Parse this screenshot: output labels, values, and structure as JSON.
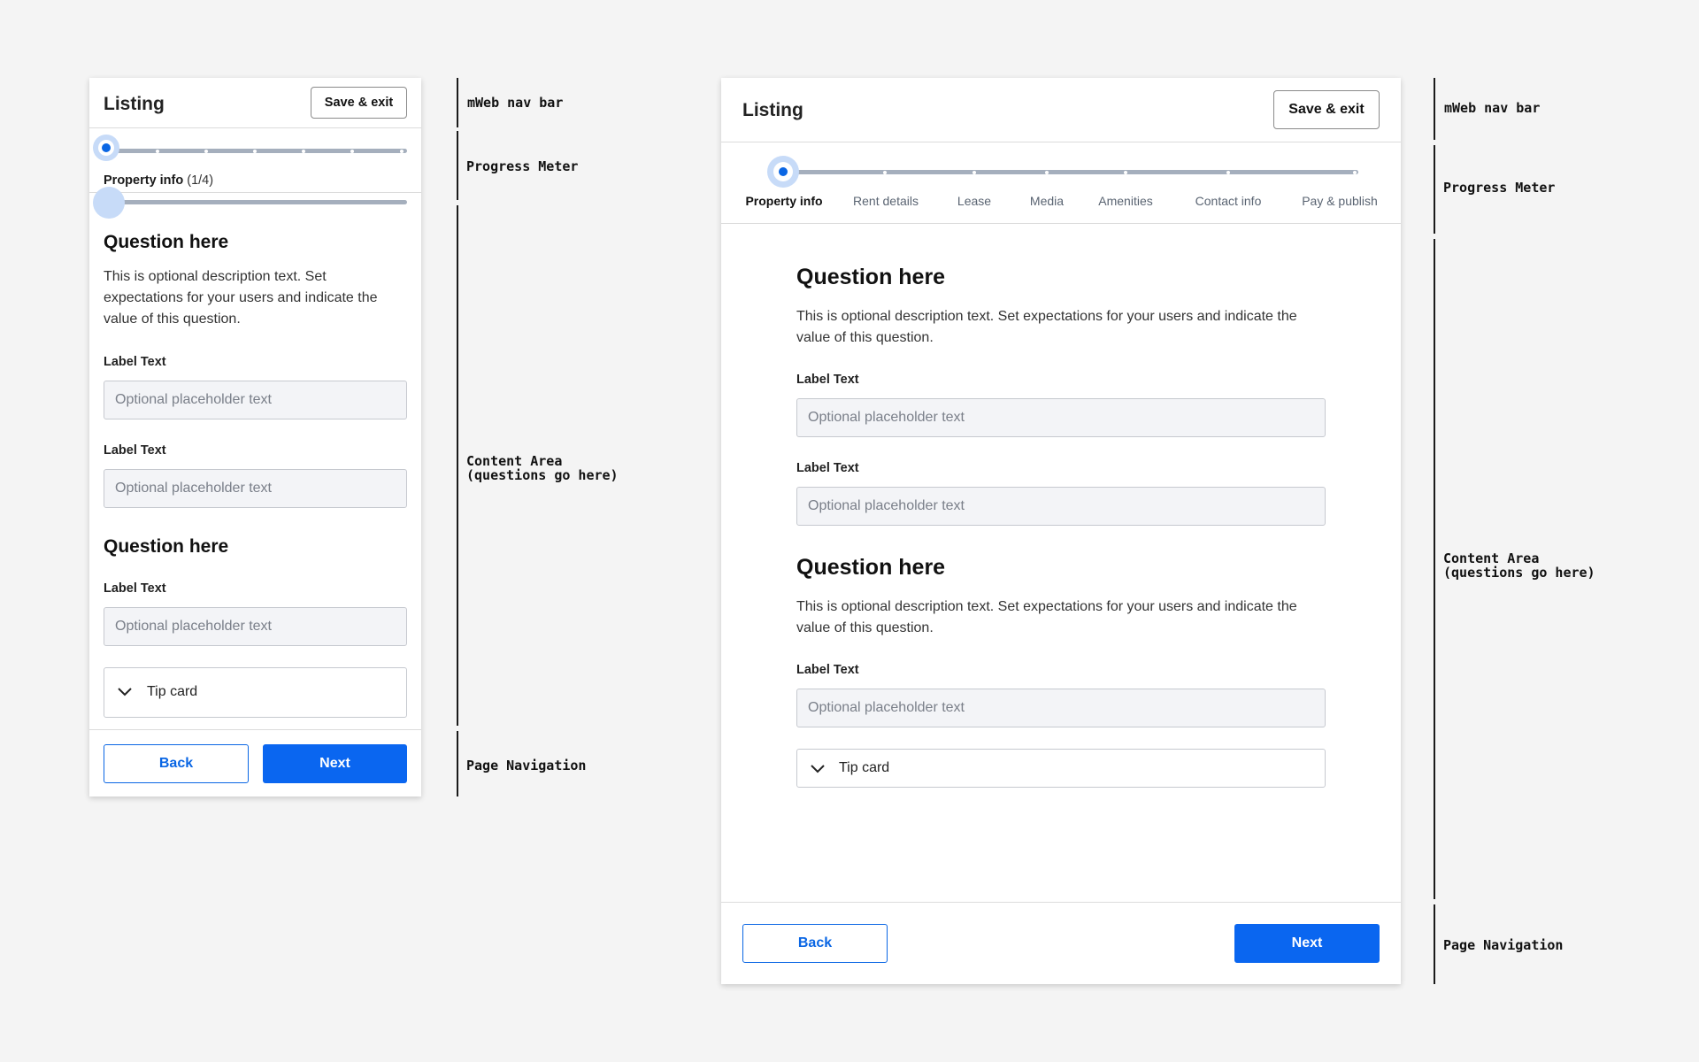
{
  "mobile": {
    "nav": {
      "title": "Listing",
      "save_label": "Save & exit"
    },
    "progress": {
      "current_step": 1,
      "total_steps": 4,
      "step_name": "Property info",
      "step_count": "(1/4)"
    },
    "section1": {
      "title": "Question here",
      "description": "This is optional description text. Set expectations for your users and indicate the value of this question.",
      "fields": [
        {
          "label": "Label Text",
          "placeholder": "Optional placeholder text"
        },
        {
          "label": "Label Text",
          "placeholder": "Optional placeholder text"
        }
      ]
    },
    "section2": {
      "title": "Question here",
      "fields": [
        {
          "label": "Label Text",
          "placeholder": "Optional placeholder text"
        }
      ],
      "tip_label": "Tip card"
    },
    "footer": {
      "back_label": "Back",
      "next_label": "Next"
    }
  },
  "desktop": {
    "nav": {
      "title": "Listing",
      "save_label": "Save & exit"
    },
    "steps": [
      "Property info",
      "Rent details",
      "Lease",
      "Media",
      "Amenities",
      "Contact info",
      "Pay & publish"
    ],
    "section1": {
      "title": "Question here",
      "description": "This is optional description text. Set expectations for your users and indicate the value of this question.",
      "fields": [
        {
          "label": "Label Text",
          "placeholder": "Optional placeholder text"
        },
        {
          "label": "Label Text",
          "placeholder": "Optional placeholder text"
        }
      ]
    },
    "section2": {
      "title": "Question here",
      "description": "This is optional description text. Set expectations for your users and indicate the value of this question.",
      "fields": [
        {
          "label": "Label Text",
          "placeholder": "Optional placeholder text"
        }
      ],
      "tip_label": "Tip card"
    },
    "footer": {
      "back_label": "Back",
      "next_label": "Next"
    }
  },
  "annotations": {
    "left": {
      "nav": "mWeb nav bar",
      "progress": "Progress Meter",
      "content": "Content Area\n(questions go here)",
      "pagenav": "Page Navigation"
    },
    "right": {
      "nav": "mWeb nav bar",
      "progress": "Progress Meter",
      "content": "Content Area\n(questions go here)",
      "pagenav": "Page Navigation"
    }
  },
  "colors": {
    "primary": "#0a66f0",
    "track": "#a5afbd",
    "background": "#f4f4f4",
    "input_bg": "#f3f4f7"
  },
  "icons": [
    "chevron-down-icon",
    "progress-current-marker"
  ]
}
